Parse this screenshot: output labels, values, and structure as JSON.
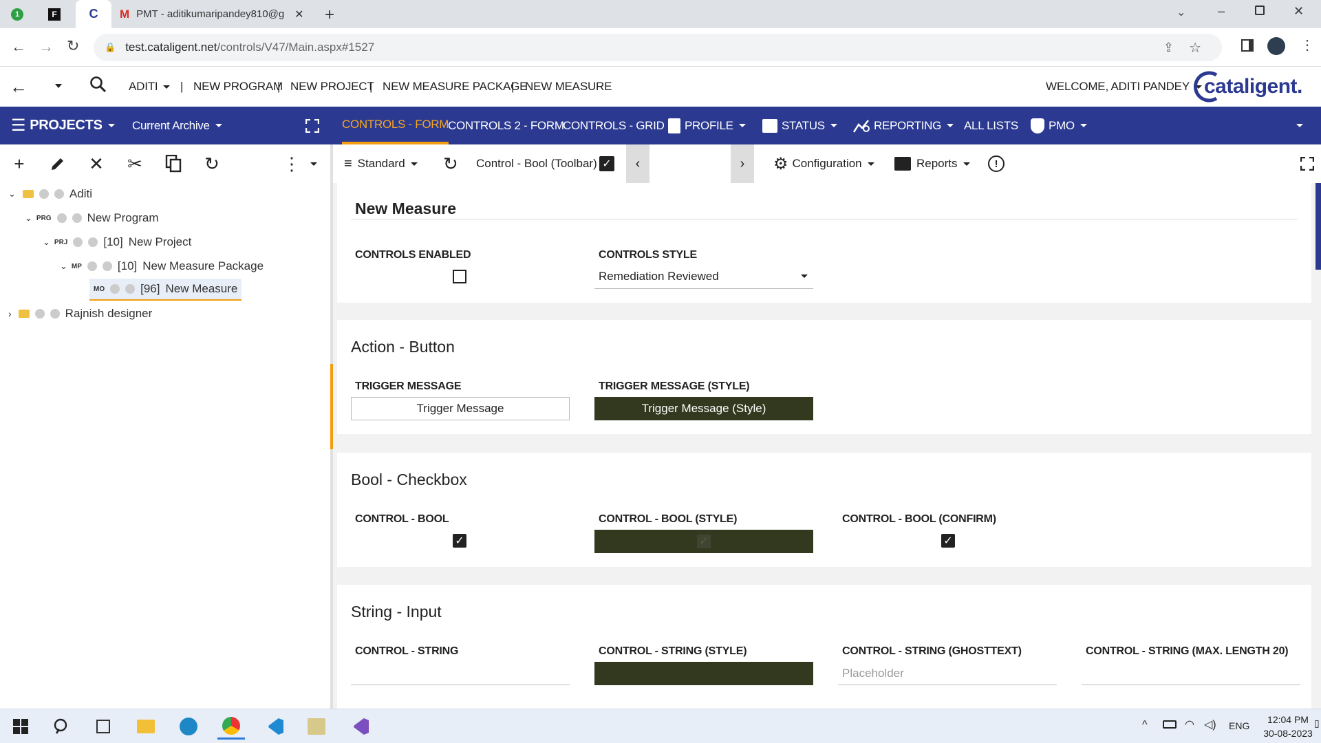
{
  "browser": {
    "tabs": [
      {
        "label": ""
      },
      {
        "label": ""
      },
      {
        "label": ""
      },
      {
        "label": "PMT - aditikumaripandey810@g"
      }
    ],
    "url_domain": "test.cataligent.net",
    "url_path": "/controls/V47/Main.aspx#1527"
  },
  "header": {
    "user_menu": "ADITI",
    "links": [
      "NEW PROGRAM",
      "NEW PROJECT",
      "NEW MEASURE PACKAGE",
      "NEW MEASURE"
    ],
    "welcome": "WELCOME, ADITI PANDEY",
    "logo_text": "cataligent."
  },
  "leftnav": {
    "title": "PROJECTS",
    "archive": "Current Archive"
  },
  "topnav": {
    "items": [
      "CONTROLS - FORM",
      "CONTROLS 2 - FORM",
      "CONTROLS - GRID",
      "PROFILE",
      "STATUS",
      "REPORTING",
      "ALL LISTS",
      "PMO"
    ],
    "active": "CONTROLS - FORM"
  },
  "tree": [
    {
      "tag": "",
      "id": "",
      "label": "Aditi"
    },
    {
      "tag": "PRG",
      "id": "",
      "label": "New Program"
    },
    {
      "tag": "PRJ",
      "id": "[10]",
      "label": "New Project"
    },
    {
      "tag": "MP",
      "id": "[10]",
      "label": "New Measure Package"
    },
    {
      "tag": "MO",
      "id": "[96]",
      "label": "New Measure"
    },
    {
      "tag": "",
      "id": "",
      "label": "Rajnish designer"
    }
  ],
  "toolbar": {
    "view": "Standard",
    "control_bool_label": "Control - Bool (Toolbar)",
    "configuration": "Configuration",
    "reports": "Reports"
  },
  "sections": {
    "measure": {
      "title": "New Measure",
      "controls_enabled_label": "CONTROLS ENABLED",
      "controls_style_label": "CONTROLS STYLE",
      "controls_style_value": "Remediation Reviewed"
    },
    "action": {
      "title": "Action - Button",
      "trigger_label": "TRIGGER MESSAGE",
      "trigger_button": "Trigger Message",
      "trigger_style_label": "TRIGGER MESSAGE (STYLE)",
      "trigger_style_button": "Trigger Message (Style)"
    },
    "bool": {
      "title": "Bool - Checkbox",
      "bool_label": "CONTROL - BOOL",
      "bool_style_label": "CONTROL - BOOL (STYLE)",
      "bool_confirm_label": "CONTROL - BOOL (CONFIRM)"
    },
    "string": {
      "title": "String - Input",
      "string_label": "CONTROL - STRING",
      "string_style_label": "CONTROL - STRING (STYLE)",
      "string_ghost_label": "CONTROL - STRING (GHOSTTEXT)",
      "string_ghost_placeholder": "Placeholder",
      "string_max_label": "CONTROL - STRING (MAX. LENGTH 20)"
    }
  },
  "taskbar": {
    "lang": "ENG",
    "time": "12:04 PM",
    "date": "30-08-2023"
  },
  "colors": {
    "navy": "#2b3990",
    "accent_orange": "#f39c12",
    "dark_olive": "#33391f"
  }
}
